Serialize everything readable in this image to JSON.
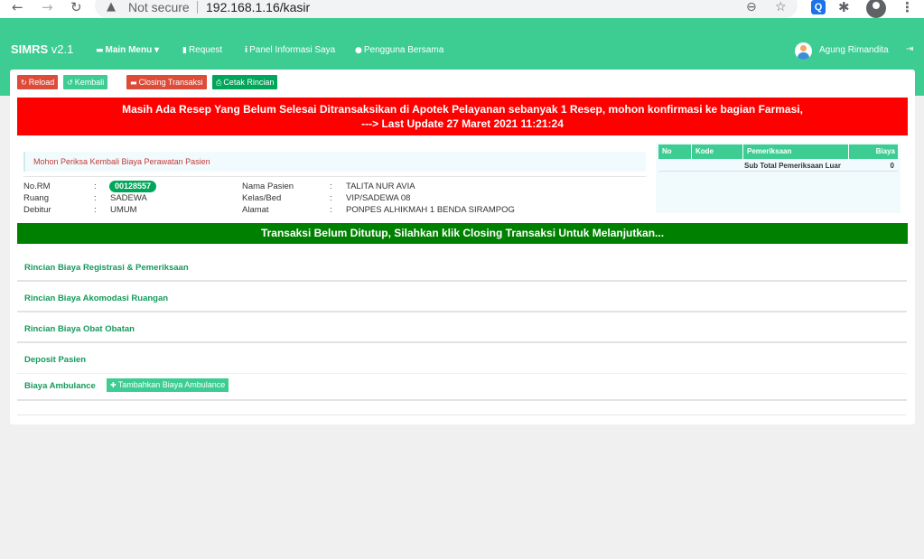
{
  "browser": {
    "back_icon": "←",
    "forward_icon": "→",
    "reload_icon": "↻",
    "security_icon": "▲",
    "security_text": "Not secure",
    "url": "192.168.1.16/kasir",
    "zoom_icon": "⊖",
    "star_icon": "☆",
    "ext_search_icon": "Q",
    "puzzle_icon": "✱",
    "menu_icon": "⋮"
  },
  "header": {
    "brand": "SIMRS",
    "version": "v2.1",
    "menu": [
      {
        "label": "Main Menu",
        "icon": "folder-icon",
        "glyph": "▬",
        "caret": "▾"
      },
      {
        "label": "Request",
        "icon": "file-icon",
        "glyph": "▮"
      },
      {
        "label": "Panel Informasi Saya",
        "icon": "info-icon",
        "glyph": "i"
      },
      {
        "label": "Pengguna Bersama",
        "icon": "users-icon",
        "glyph": "●"
      }
    ],
    "user_name": "Agung Rimandita",
    "logout_icon": "⇥"
  },
  "toolbar": {
    "reload": {
      "label": "Reload",
      "icon": "↻"
    },
    "kembali": {
      "label": "Kembali",
      "icon": "↺"
    },
    "closing": {
      "label": "Closing Transaksi",
      "icon": "▬"
    },
    "cetak": {
      "label": "Cetak Rincian",
      "icon": "⎙"
    }
  },
  "alert_red": {
    "line1": "Masih Ada Resep Yang Belum Selesai Ditransaksikan di Apotek Pelayanan sebanyak 1 Resep, mohon konfirmasi ke bagian Farmasi,",
    "line2": "---> Last Update 27 Maret 2021 11:21:24"
  },
  "notice": "Mohon Periksa Kembali Biaya Perawatan Pasien",
  "patient": {
    "sep": ":",
    "no_rm_label": "No.RM",
    "no_rm": "00128557",
    "ruang_label": "Ruang",
    "ruang": "SADEWA",
    "debitur_label": "Debitur",
    "debitur": "UMUM",
    "nama_label": "Nama Pasien",
    "nama": "TALITA NUR AVIA",
    "kelas_label": "Kelas/Bed",
    "kelas": "VIP/SADEWA 08",
    "alamat_label": "Alamat",
    "alamat": "PONPES ALHIKMAH 1 BENDA SIRAMPOG"
  },
  "exam_table": {
    "headers": [
      "No",
      "Kode",
      "Pemeriksaan",
      "Biaya"
    ],
    "subtotal_label": "Sub Total Pemeriksaan Luar",
    "subtotal_value": "0"
  },
  "alert_green": "Transaksi Belum Ditutup, Silahkan klik Closing Transaksi Untuk Melanjutkan...",
  "sections": {
    "registrasi": "Rincian Biaya Registrasi & Pemeriksaan",
    "akomodasi": "Rincian Biaya Akomodasi Ruangan",
    "obat": "Rincian Biaya Obat Obatan",
    "deposit": "Deposit Pasien",
    "ambulance": "Biaya Ambulance",
    "add_ambulance": {
      "label": "Tambahkan Biaya Ambulance",
      "icon": "✚"
    }
  }
}
